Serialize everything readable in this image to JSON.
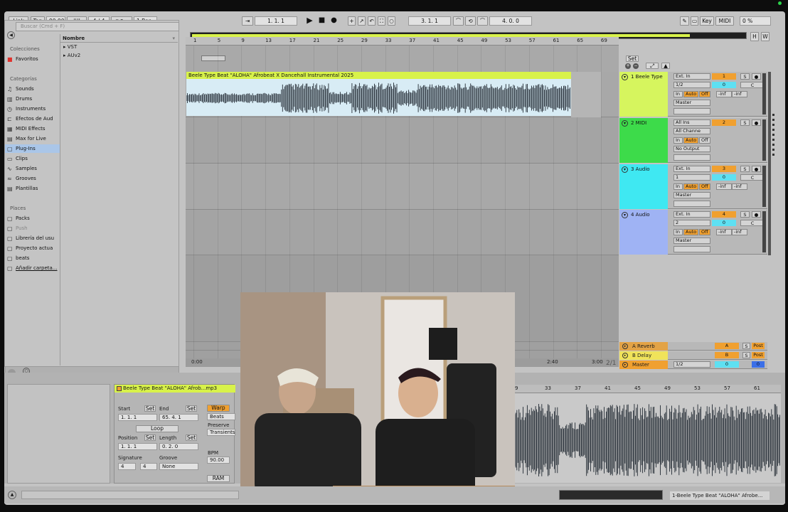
{
  "transport": {
    "link": "Link",
    "tap": "Tap",
    "tempo": "90.00",
    "signature": "4 / 4",
    "quantize": "1 Bar",
    "position": "1.   1.   1",
    "loop_start": "3.   1.   1",
    "loop_length": "4.   0.   0",
    "key_label": "Key",
    "midi_label": "MIDI",
    "cpu": "0 %"
  },
  "browser": {
    "search_placeholder": "Buscar (Cmd + F)",
    "collections_heading": "Colecciones",
    "favorites": "Favoritos",
    "categories_heading": "Categorías",
    "categories": [
      "Sounds",
      "Drums",
      "Instruments",
      "Efectos de Aud",
      "MIDI Effects",
      "Max for Live",
      "Plug-Ins",
      "Clips",
      "Samples",
      "Grooves",
      "Plantillas"
    ],
    "places_heading": "Places",
    "places": [
      "Packs",
      "Push",
      "Librería del usu",
      "Proyecto actua",
      "beats",
      "Añadir carpeta..."
    ],
    "name_heading": "Nombre",
    "tree": [
      "VST",
      "AUv2"
    ]
  },
  "ruler_bars": [
    "1",
    "5",
    "9",
    "13",
    "17",
    "21",
    "25",
    "29",
    "33",
    "37",
    "41",
    "45",
    "49",
    "53",
    "57",
    "61",
    "65",
    "69"
  ],
  "clip": {
    "title": "Beele Type Beat \"ALOHA\" Afrobeat X Dancehall Instrumental 2025"
  },
  "tracks": [
    {
      "name": "1 Beele Type",
      "input": "Ext. In",
      "channel": "1/2",
      "output": "Master",
      "number": "1",
      "vol": "0",
      "pan": "C",
      "color": "#d6f55e"
    },
    {
      "name": "2 MIDI",
      "input": "All Ins",
      "channel": "All Channe",
      "output": "No Output",
      "number": "2",
      "vol": "",
      "pan": "",
      "color": "#3ddb4a"
    },
    {
      "name": "3 Audio",
      "input": "Ext. In",
      "channel": "1",
      "output": "Master",
      "number": "3",
      "vol": "0",
      "pan": "C",
      "color": "#3fe8f2"
    },
    {
      "name": "4 Audio",
      "input": "Ext. In",
      "channel": "2",
      "output": "Master",
      "number": "4",
      "vol": "0",
      "pan": "C",
      "color": "#9fb3f4"
    }
  ],
  "monitor": {
    "in": "In",
    "auto": "Auto",
    "off": "Off",
    "inf": "-inf",
    "solo": "S"
  },
  "returns": [
    {
      "name": "A Reverb",
      "letter": "A",
      "post": "Post",
      "color": "#e3a346"
    },
    {
      "name": "B Delay",
      "letter": "B",
      "post": "Post",
      "color": "#f0e35a"
    },
    {
      "name": "Master",
      "letter": "0",
      "post": "0",
      "channel": "1/2",
      "color": "#f0a030"
    }
  ],
  "set_label": "Set",
  "timeline": {
    "t0": "0:00",
    "t1": "2:40",
    "t2": "3:00",
    "page": "2/1"
  },
  "clipview": {
    "title": "Beele Type Beat \"ALOHA\" Afrob...mp3",
    "start_label": "Start",
    "end_label": "End",
    "set": "Set",
    "start_val": "1.    1.    1",
    "end_val": "65.    4.    1",
    "loop": "Loop",
    "position_label": "Position",
    "length_label": "Length",
    "position_val": "1.    1.    1",
    "length_val": "0.    2.    0",
    "signature_label": "Signature",
    "groove_label": "Groove",
    "sig_num": "4",
    "sig_den": "4",
    "groove_val": "None",
    "warp": "Warp",
    "beats": "Beats",
    "preserve": "Preserve",
    "transients": "Transients",
    "bpm_label": "BPM",
    "bpm": "90.00",
    "ram": "RAM"
  },
  "sample_ruler": [
    "9",
    "33",
    "37",
    "41",
    "45",
    "49",
    "53",
    "57",
    "61"
  ],
  "status_clip": "1-Beele Type Beat \"ALOHA\" Afrobe...",
  "colors": {
    "accent_orange": "#f0a030",
    "blue_selection": "#aac6e8",
    "clip_green": "#d8f24a",
    "waveform": "#222a33"
  }
}
